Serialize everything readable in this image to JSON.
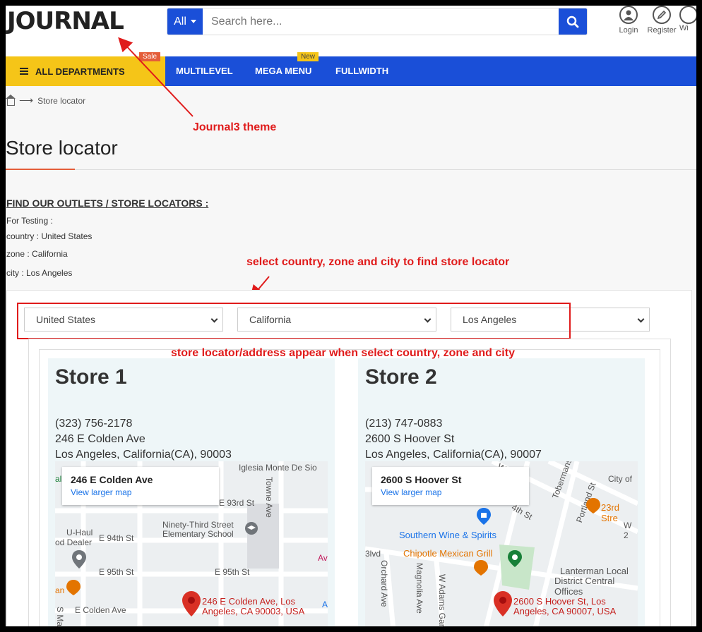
{
  "header": {
    "logo": "JOURNAL",
    "search_category": "All",
    "search_placeholder": "Search here...",
    "icons": [
      {
        "label": "Login",
        "icon": "user-icon"
      },
      {
        "label": "Register",
        "icon": "pencil-icon"
      },
      {
        "label": "Wi",
        "icon": "heart-icon"
      }
    ]
  },
  "nav": {
    "departments": "ALL DEPARTMENTS",
    "sale_badge": "Sale",
    "new_badge": "New",
    "links": [
      "MULTILEVEL",
      "MEGA MENU",
      "FULLWIDTH"
    ]
  },
  "breadcrumb": {
    "current": "Store locator"
  },
  "annotations": {
    "theme": "Journal3 theme",
    "select_hint": "select country, zone and city to find store locator",
    "appear_hint": "store locator/address appear when select country, zone and city"
  },
  "page": {
    "title": "Store locator",
    "find_heading": "FIND OUR OUTLETS / STORE LOCATORS :",
    "testing": [
      "For Testing :",
      "country : United States",
      "zone : California",
      "city : Los Angeles"
    ]
  },
  "filters": {
    "country": "United States",
    "zone": "California",
    "city": "Los Angeles"
  },
  "stores": [
    {
      "name": "Store 1",
      "phone": "(323) 756-2178",
      "street": "246 E Colden Ave",
      "city_line": "Los Angeles, California(CA), 90003",
      "map_card_title": "246 E Colden Ave",
      "map_card_link": "View larger map",
      "pin_label_1": "246 E Colden Ave, Los",
      "pin_label_2": "Angeles, CA 90003, USA",
      "map_labels": {
        "a": "Iglesia Monte De Sio",
        "b": "Towne Ave",
        "c": "E 93rd St",
        "d": "Ninety-Third Street",
        "e": "Elementary School",
        "f": "U-Haul",
        "g": "od Dealer",
        "h": "E 94th St",
        "i": "E 95th St",
        "j": "E 95th St",
        "k": "E Colden Ave",
        "l": "an",
        "m": "al",
        "n": "Av",
        "o": "A",
        "p": "S Ma"
      }
    },
    {
      "name": "Store 2",
      "phone": "(213) 747-0883",
      "street": "2600 S Hoover St",
      "city_line": "Los Angeles, California(CA), 90007",
      "map_card_title": "2600 S Hoover St",
      "map_card_link": "View larger map",
      "pin_label_1": "2600 S Hoover St, Los",
      "pin_label_2": "Angeles, CA 90007, USA",
      "map_labels": {
        "a": "City of",
        "b": "23rd Stre",
        "c": "Southern Wine & Spirits",
        "d": "Chipotle Mexican Grill",
        "e": "Lanterman Local",
        "f": "District Central Offices",
        "g": "Tobermanst",
        "h": "Portland St",
        "i": "Orchard Ave",
        "j": "Magnolia Ave",
        "k": "W Adams Gar",
        "l": "3lvd",
        "m": "W 2",
        "n": "W 2",
        "o": "4th St"
      }
    }
  ]
}
